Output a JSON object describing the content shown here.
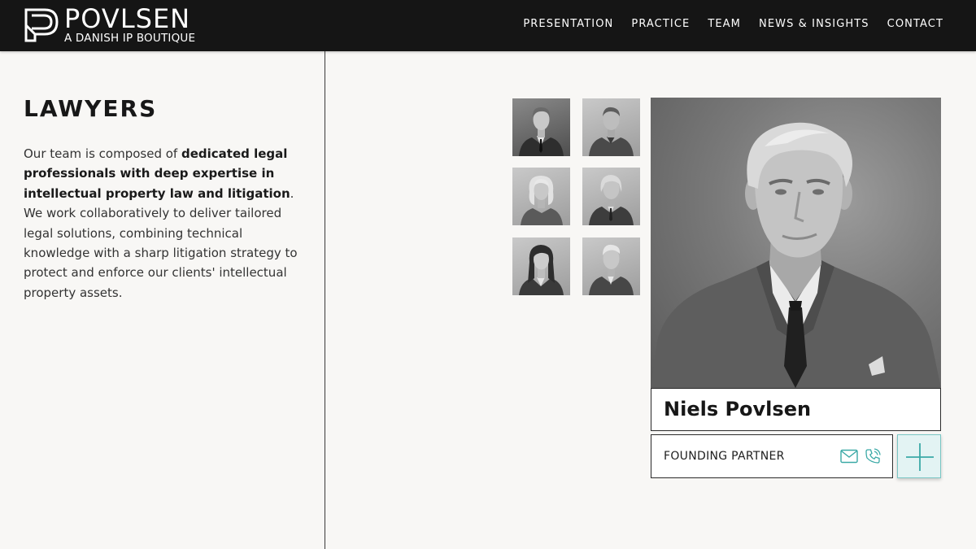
{
  "header": {
    "logo": {
      "name": "POVLSEN",
      "tagline": "A DANISH IP BOUTIQUE"
    },
    "nav": [
      {
        "label": "PRESENTATION"
      },
      {
        "label": "PRACTICE"
      },
      {
        "label": "TEAM"
      },
      {
        "label": "NEWS & INSIGHTS"
      },
      {
        "label": "CONTACT"
      }
    ]
  },
  "intro": {
    "title": "LAWYERS",
    "text_before": "Our team is composed of ",
    "text_bold": "dedicated legal professionals with deep expertise in intellectual property law and litigation",
    "text_after": ". We work collaboratively to deliver tailored legal solutions, combining technical knowledge with a sharp litigation strategy to protect and enforce our clients' intellectual property assets."
  },
  "thumbnails": [
    {
      "icon": "portrait-man-suit-icon",
      "active": true
    },
    {
      "icon": "portrait-man-icon",
      "active": false
    },
    {
      "icon": "portrait-woman-blonde-icon",
      "active": false
    },
    {
      "icon": "portrait-man-long-hair-icon",
      "active": false
    },
    {
      "icon": "portrait-woman-dark-hair-icon",
      "active": false
    },
    {
      "icon": "portrait-man-young-icon",
      "active": false
    }
  ],
  "featured": {
    "name": "Niels Povlsen",
    "role": "FOUNDING PARTNER",
    "icons": [
      "mail-icon",
      "phone-icon",
      "plus-icon"
    ]
  },
  "colors": {
    "header_bg": "#151515",
    "page_bg": "#f8f7f5",
    "accent": "#3aa9a6",
    "accent_bg": "#e3f3f3"
  }
}
